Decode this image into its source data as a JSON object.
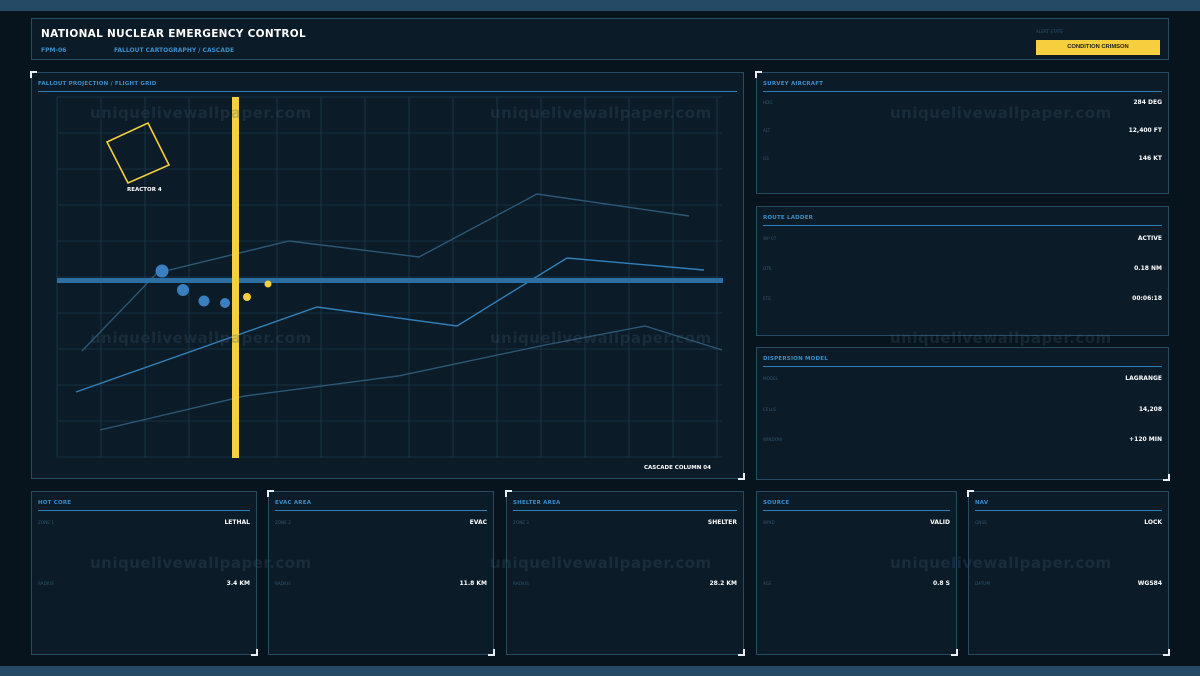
{
  "header": {
    "title": "NATIONAL NUCLEAR EMERGENCY CONTROL",
    "id": "FPM-06",
    "subtitle": "FALLOUT CARTOGRAPHY / CASCADE",
    "alert_label": "ALERT STATE",
    "alert_button": "CONDITION CRIMSON"
  },
  "map": {
    "title": "FALLOUT PROJECTION / FLIGHT GRID",
    "reactor_label": "REACTOR 4",
    "column_label": "CASCADE COLUMN 04"
  },
  "survey_aircraft": {
    "title": "SURVEY AIRCRAFT",
    "rows": [
      {
        "key": "HDG",
        "value": "284 DEG"
      },
      {
        "key": "ALT",
        "value": "12,400 FT"
      },
      {
        "key": "GS",
        "value": "146 KT"
      }
    ]
  },
  "route_ladder": {
    "title": "ROUTE LADDER",
    "rows": [
      {
        "key": "WP 07",
        "value": "ACTIVE"
      },
      {
        "key": "DTK",
        "value": "0.18 NM"
      },
      {
        "key": "ETE",
        "value": "00:06:18"
      }
    ]
  },
  "dispersion_model": {
    "title": "DISPERSION MODEL",
    "rows": [
      {
        "key": "MODEL",
        "value": "LAGRANGE"
      },
      {
        "key": "CELLS",
        "value": "14,208"
      },
      {
        "key": "WINDOW",
        "value": "+120 MIN"
      }
    ]
  },
  "hot_core": {
    "title": "HOT CORE",
    "rows": [
      {
        "key": "ZONE 1",
        "value": "LETHAL"
      },
      {
        "key": "RADIUS",
        "value": "3.4 KM"
      }
    ]
  },
  "evac_area": {
    "title": "EVAC AREA",
    "rows": [
      {
        "key": "ZONE 2",
        "value": "EVAC"
      },
      {
        "key": "RADIUS",
        "value": "11.8 KM"
      }
    ]
  },
  "shelter_area": {
    "title": "SHELTER AREA",
    "rows": [
      {
        "key": "ZONE 3",
        "value": "SHELTER"
      },
      {
        "key": "RADIUS",
        "value": "28.2 KM"
      }
    ]
  },
  "source": {
    "title": "SOURCE",
    "rows": [
      {
        "key": "WIND",
        "value": "VALID"
      },
      {
        "key": "AGE",
        "value": "0.8 S"
      }
    ]
  },
  "nav": {
    "title": "NAV",
    "rows": [
      {
        "key": "GNSS",
        "value": "LOCK"
      },
      {
        "key": "DATUM",
        "value": "WGS84"
      }
    ]
  },
  "watermark": "uniquelivewallpaper.com",
  "colors": {
    "accent_blue": "#2f7fb8",
    "accent_yellow": "#f5cf3d",
    "background": "#08141d",
    "panel": "#0b1b27"
  }
}
